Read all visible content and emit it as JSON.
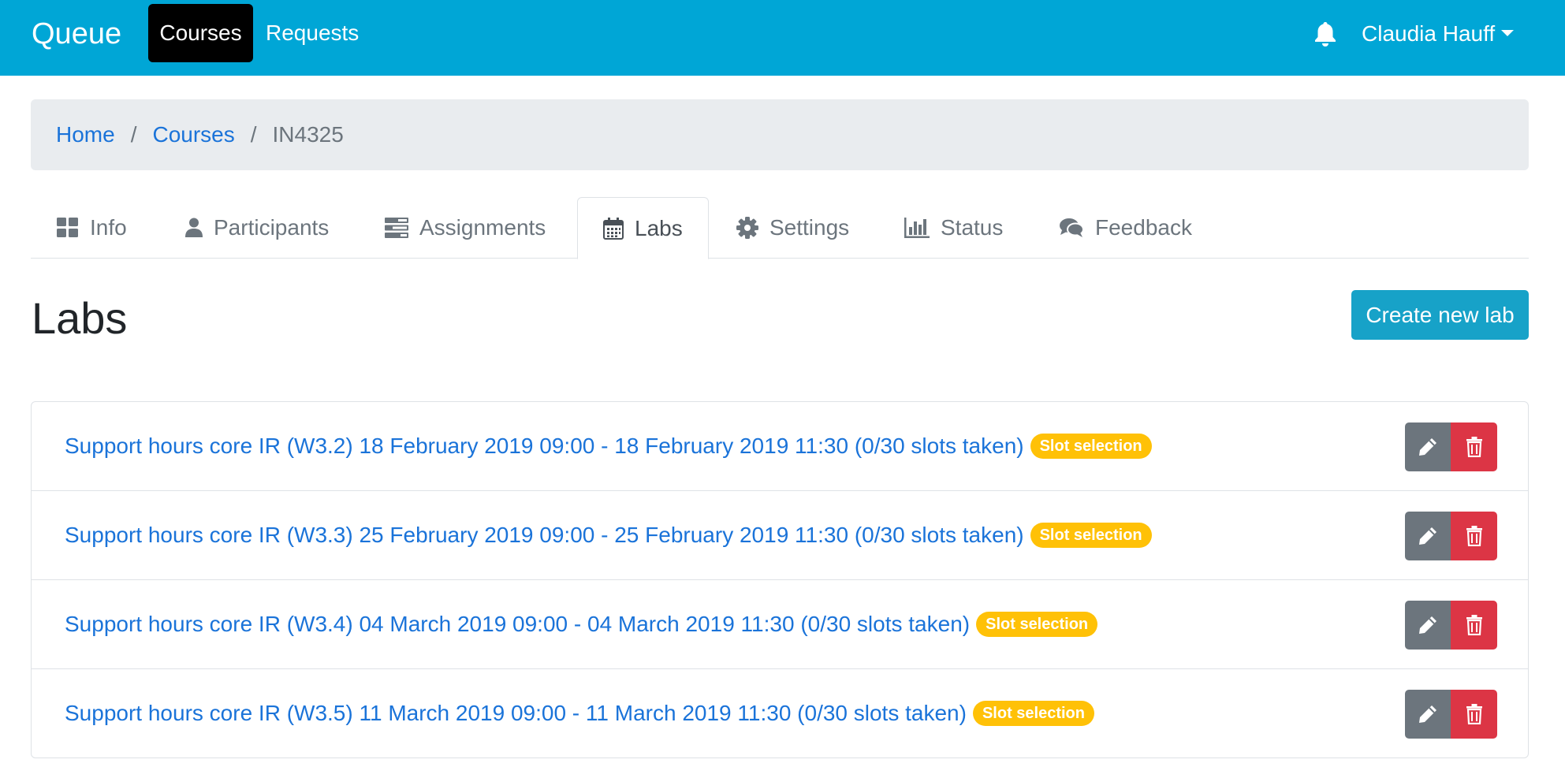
{
  "navbar": {
    "brand": "Queue",
    "links": [
      {
        "label": "Courses"
      },
      {
        "label": "Requests"
      }
    ],
    "user": "Claudia Hauff"
  },
  "breadcrumb": {
    "items": [
      "Home",
      "Courses",
      "IN4325"
    ],
    "separator": "/"
  },
  "tabs": [
    {
      "label": "Info",
      "icon": "th-large-icon"
    },
    {
      "label": "Participants",
      "icon": "user-icon"
    },
    {
      "label": "Assignments",
      "icon": "tasks-icon"
    },
    {
      "label": "Labs",
      "icon": "calendar-icon",
      "active": true
    },
    {
      "label": "Settings",
      "icon": "gear-icon"
    },
    {
      "label": "Status",
      "icon": "bar-chart-icon"
    },
    {
      "label": "Feedback",
      "icon": "comments-icon"
    }
  ],
  "page": {
    "title": "Labs",
    "create_label": "Create new lab"
  },
  "labs": [
    {
      "title": "Support hours core IR (W3.2) 18 February 2019 09:00 - 18 February 2019 11:30 (0/30 slots taken)",
      "badge": "Slot selection"
    },
    {
      "title": "Support hours core IR (W3.3) 25 February 2019 09:00 - 25 February 2019 11:30 (0/30 slots taken)",
      "badge": "Slot selection"
    },
    {
      "title": "Support hours core IR (W3.4) 04 March 2019 09:00 - 04 March 2019 11:30 (0/30 slots taken)",
      "badge": "Slot selection"
    },
    {
      "title": "Support hours core IR (W3.5) 11 March 2019 09:00 - 11 March 2019 11:30 (0/30 slots taken)",
      "badge": "Slot selection"
    }
  ],
  "colors": {
    "navbar": "#00a6d6",
    "link": "#1a73d9",
    "badge": "#ffc107",
    "edit": "#6c757d",
    "delete": "#dc3545"
  }
}
